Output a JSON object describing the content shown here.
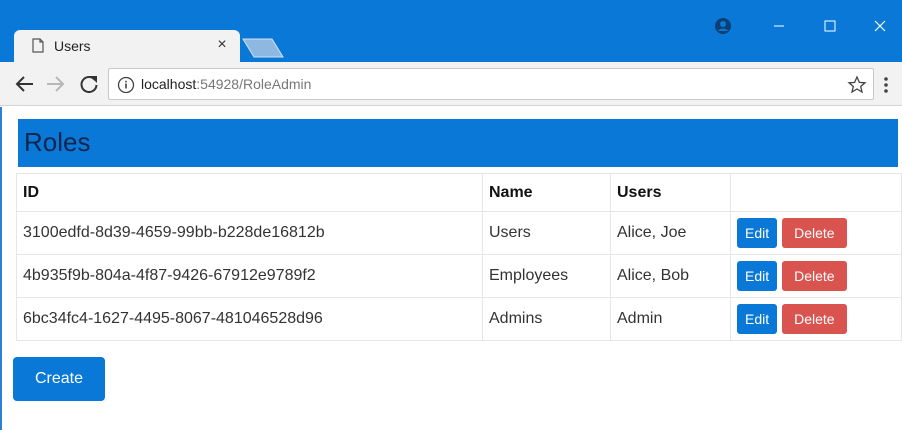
{
  "browser": {
    "tab_title": "Users",
    "tab_close": "×",
    "url_host": "localhost",
    "url_rest": ":54928/RoleAdmin"
  },
  "page": {
    "heading": "Roles",
    "table": {
      "headers": [
        "ID",
        "Name",
        "Users",
        ""
      ],
      "rows": [
        {
          "id": "3100edfd-8d39-4659-99bb-b228de16812b",
          "name": "Users",
          "users": "Alice, Joe"
        },
        {
          "id": "4b935f9b-804a-4f87-9426-67912e9789f2",
          "name": "Employees",
          "users": "Alice, Bob"
        },
        {
          "id": "6bc34fc4-1627-4495-8067-481046528d96",
          "name": "Admins",
          "users": "Admin"
        }
      ]
    },
    "edit_label": "Edit",
    "delete_label": "Delete",
    "create_label": "Create"
  },
  "colors": {
    "accent": "#0a78d7",
    "danger": "#d9534f",
    "chrome": "#f2f2f2"
  },
  "icons": [
    "page-icon",
    "close-icon",
    "new-tab-icon",
    "account-icon",
    "minimize-icon",
    "maximize-icon",
    "window-close-icon",
    "back-icon",
    "forward-icon",
    "reload-icon",
    "info-icon",
    "star-icon",
    "menu-icon"
  ]
}
